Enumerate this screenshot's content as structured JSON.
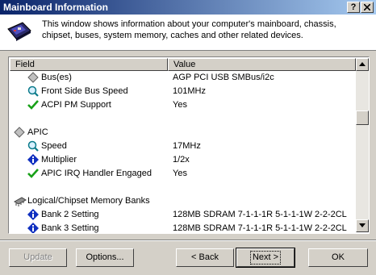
{
  "window": {
    "title": "Mainboard Information"
  },
  "titlebar_buttons": {
    "help": "?",
    "close": "X"
  },
  "header": {
    "description": "This window shows information about your computer's mainboard, chassis, chipset, buses, system memory, caches and other related devices."
  },
  "list": {
    "columns": {
      "field": "Field",
      "value": "Value"
    },
    "rows": [
      {
        "icon": "gray-diamond-icon",
        "field": "Bus(es)",
        "value": "AGP PCI USB SMBus/i2c"
      },
      {
        "icon": "magnifier-icon",
        "field": "Front Side Bus Speed",
        "value": "101MHz"
      },
      {
        "icon": "green-check-icon",
        "field": "ACPI PM Support",
        "value": "Yes"
      },
      {
        "icon": "",
        "field": "",
        "value": ""
      },
      {
        "icon": "gray-diamond-icon",
        "field": "APIC",
        "value": ""
      },
      {
        "icon": "magnifier-icon",
        "field": "Speed",
        "value": "17MHz"
      },
      {
        "icon": "blue-info-icon",
        "field": "Multiplier",
        "value": "1/2x"
      },
      {
        "icon": "green-check-icon",
        "field": "APIC IRQ Handler Engaged",
        "value": "Yes"
      },
      {
        "icon": "",
        "field": "",
        "value": ""
      },
      {
        "icon": "memory-chip-icon",
        "field": "Logical/Chipset Memory Banks",
        "value": ""
      },
      {
        "icon": "blue-info-icon",
        "field": "Bank 2 Setting",
        "value": "128MB SDRAM 7-1-1-1R 5-1-1-1W 2-2-2CL"
      },
      {
        "icon": "blue-info-icon",
        "field": "Bank 3 Setting",
        "value": "128MB SDRAM 7-1-1-1R 5-1-1-1W 2-2-2CL"
      }
    ]
  },
  "buttons": {
    "update": "Update",
    "options": "Options...",
    "back": "< Back",
    "next": "Next >",
    "ok": "OK"
  }
}
